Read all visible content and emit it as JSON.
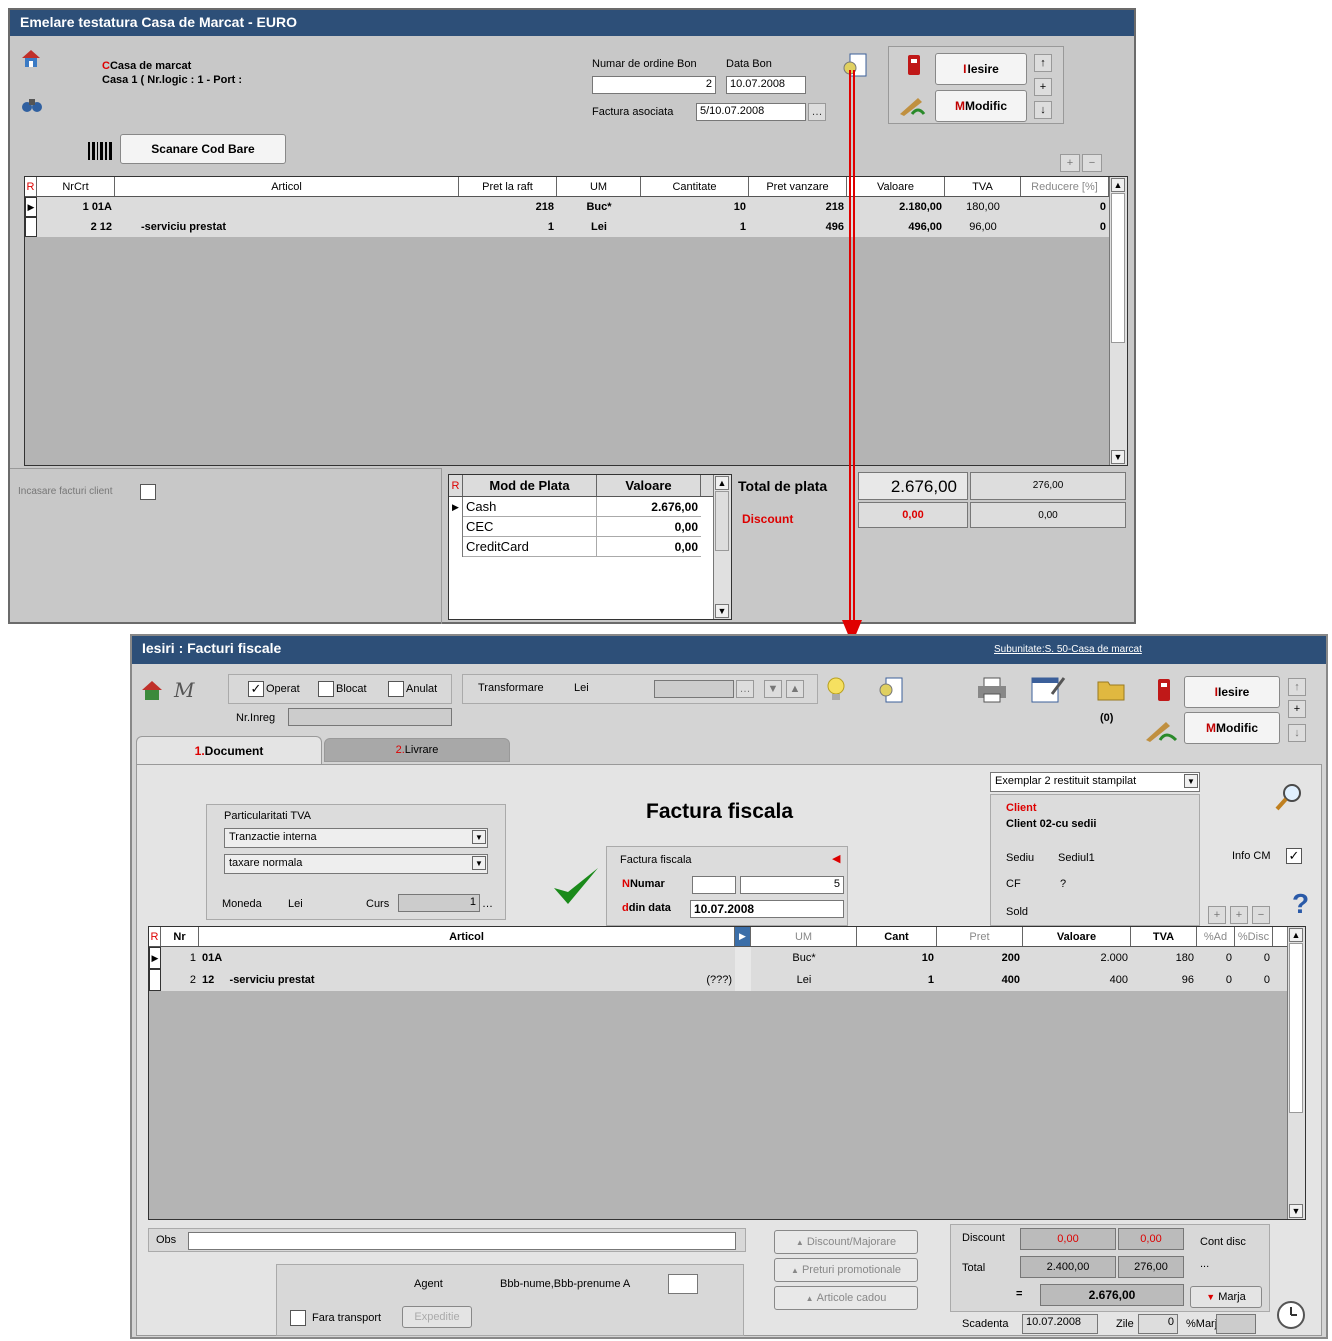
{
  "top": {
    "title": "Emelare testatura Casa de Marcat - EURO",
    "casa_label": "Casa de marcat",
    "casa_value": "Casa 1 ( Nr.logic : 1 - Port :",
    "nr_bon_label": "Numar de ordine Bon",
    "nr_bon_value": "2",
    "data_bon_label": "Data Bon",
    "data_bon_value": "10.07.2008",
    "factura_label": "Factura asociata",
    "factura_value": "5/10.07.2008",
    "iesire_label": "Iesire",
    "modific_label": "Modific",
    "scan_label": "Scanare Cod Bare",
    "columns": [
      "R",
      "NrCrt",
      "Articol",
      "Pret la raft",
      "UM",
      "Cantitate",
      "Pret vanzare",
      "Valoare",
      "TVA",
      "Reducere [%]"
    ],
    "rows": [
      {
        "nr": "1",
        "cod": "01A",
        "art": "",
        "pret_raft": "218",
        "um": "Buc*",
        "cant": "10",
        "pret_v": "218",
        "val": "2.180,00",
        "tva": "180,00",
        "red": "0"
      },
      {
        "nr": "2",
        "cod": "12",
        "art": "-serviciu prestat",
        "pret_raft": "1",
        "um": "Lei",
        "cant": "1",
        "pret_v": "496",
        "val": "496,00",
        "tva": "96,00",
        "red": "0"
      }
    ],
    "incasare_label": "Incasare facturi client",
    "plata_columns": [
      "R",
      "Mod de Plata",
      "Valoare"
    ],
    "plata_rows": [
      {
        "mod": "Cash",
        "val": "2.676,00"
      },
      {
        "mod": "CEC",
        "val": "0,00"
      },
      {
        "mod": "CreditCard",
        "val": "0,00"
      }
    ],
    "total_label": "Total de plata",
    "total_value": "2.676,00",
    "total_tva": "276,00",
    "discount_label": "Discount",
    "discount_value": "0,00",
    "discount_tva": "0,00"
  },
  "bottom": {
    "title": "Iesiri : Facturi fiscale",
    "subunitate_link": "Subunitate:S. 50-Casa de marcat",
    "operat_label": "Operat",
    "blocat_label": "Blocat",
    "anulat_label": "Anulat",
    "transformare_label": "Transformare",
    "transformare_value": "Lei",
    "nrinreg_label": "Nr.Inreg",
    "count_label": "(0)",
    "iesire_label": "Iesire",
    "modific_label": "Modific",
    "tab1_num": "1.",
    "tab1_label": "Document",
    "tab2_num": "2.",
    "tab2_label": "Livrare",
    "particularitati_label": "Particularitati TVA",
    "tranzactie_value": "Tranzactie interna",
    "taxare_value": "taxare normala",
    "moneda_label": "Moneda",
    "moneda_value": "Lei",
    "curs_label": "Curs",
    "curs_value": "1",
    "doc_title": "Factura fiscala",
    "fact_box_label": "Factura fiscala",
    "numar_label": "Numar",
    "numar_value": "5",
    "dindata_label": "din data",
    "dindata_value": "10.07.2008",
    "exemplar_value": "Exemplar 2 restituit stampilat",
    "client_label": "Client",
    "client_value": "Client 02-cu sedii",
    "sediu_label": "Sediu",
    "sediu_value": "Sediul1",
    "cf_label": "CF",
    "cf_value": "?",
    "sold_label": "Sold",
    "infocm_label": "Info CM",
    "columns": [
      "R",
      "Nr",
      "Articol",
      "",
      "UM",
      "Cant",
      "Pret",
      "Valoare",
      "TVA",
      "%Ad",
      "%Disc"
    ],
    "rows": [
      {
        "nr": "1",
        "cod": "01A",
        "art": "",
        "extra": "",
        "um": "Buc*",
        "cant": "10",
        "pret": "200",
        "val": "2.000",
        "tva": "180",
        "ad": "0",
        "disc": "0"
      },
      {
        "nr": "2",
        "cod": "12",
        "art": "-serviciu prestat",
        "extra": "(???)",
        "um": "Lei",
        "cant": "1",
        "pret": "400",
        "val": "400",
        "tva": "96",
        "ad": "0",
        "disc": "0"
      }
    ],
    "obs_label": "Obs",
    "agent_label": "Agent",
    "agent_value": "Bbb-nume,Bbb-prenume A",
    "fara_transport_label": "Fara transport",
    "expeditie_label": "Expeditie",
    "discount_majorare": "Discount/Majorare",
    "preturi_promo": "Preturi promotionale",
    "articole_cadou": "Articole cadou",
    "discount_label": "Discount",
    "discount_val": "0,00",
    "discount_tva": "0,00",
    "cont_disc_label": "Cont disc",
    "cont_disc_value": "...",
    "total_label": "Total",
    "total_val": "2.400,00",
    "total_tva": "276,00",
    "eq_sign": "=",
    "grand_total": "2.676,00",
    "marja_label": "Marja",
    "scadenta_label": "Scadenta",
    "scadenta_value": "10.07.2008",
    "zile_label": "Zile",
    "zile_value": "0",
    "marja_pct_label": "%Marj"
  }
}
